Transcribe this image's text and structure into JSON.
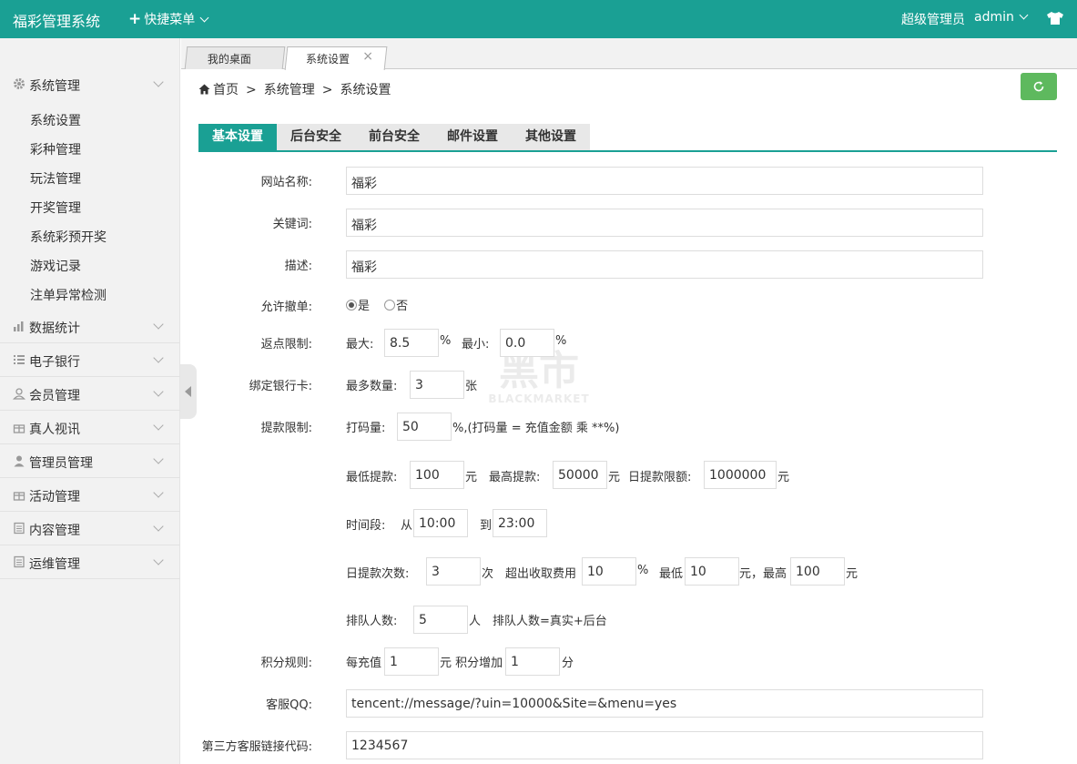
{
  "topbar": {
    "brand": "福彩管理系统",
    "quick_menu": "快捷菜单",
    "role": "超级管理员",
    "user": "admin"
  },
  "sidebar": {
    "groups": [
      {
        "label": "系统管理",
        "icon": "gear-icon"
      },
      {
        "label": "数据统计",
        "icon": "bar-chart-icon"
      },
      {
        "label": "电子银行",
        "icon": "list-icon"
      },
      {
        "label": "会员管理",
        "icon": "user-outline-icon"
      },
      {
        "label": "真人视讯",
        "icon": "gift-icon"
      },
      {
        "label": "管理员管理",
        "icon": "user-icon"
      },
      {
        "label": "活动管理",
        "icon": "gift-icon"
      },
      {
        "label": "内容管理",
        "icon": "document-icon"
      },
      {
        "label": "运维管理",
        "icon": "document-icon"
      }
    ],
    "sub_items": [
      "系统设置",
      "彩种管理",
      "玩法管理",
      "开奖管理",
      "系统彩预开奖",
      "游戏记录",
      "注单异常检测"
    ]
  },
  "page_tabs": [
    {
      "label": "我的桌面"
    },
    {
      "label": "系统设置",
      "close": "×"
    }
  ],
  "breadcrumb": {
    "home": "首页",
    "sep": ">",
    "level1": "系统管理",
    "level2": "系统设置"
  },
  "settings_tabs": [
    "基本设置",
    "后台安全",
    "前台安全",
    "邮件设置",
    "其他设置"
  ],
  "watermark": {
    "big": "黑市",
    "small": "BLACKMARKET"
  },
  "form": {
    "site_name": {
      "label": "网站名称:",
      "value": "福彩"
    },
    "keywords": {
      "label": "关键词:",
      "value": "福彩"
    },
    "description": {
      "label": "描述:",
      "value": "福彩"
    },
    "allow_cancel": {
      "label": "允许撤单:",
      "yes": "是",
      "no": "否"
    },
    "rebate": {
      "label": "返点限制:",
      "max_label": "最大:",
      "max": "8.5",
      "pct1": "%",
      "min_label": "最小:",
      "min": "0.0",
      "pct2": "%"
    },
    "bank_card": {
      "label": "绑定银行卡:",
      "max_label": "最多数量:",
      "value": "3",
      "unit": "张"
    },
    "withdraw": {
      "label": "提款限制:",
      "bet_label": "打码量:",
      "bet": "50",
      "bet_note": "%,(打码量 = 充值金额 乘 **%)",
      "min_label": "最低提款:",
      "min": "100",
      "unit_yuan1": "元",
      "max_label": "最高提款:",
      "max": "50000",
      "unit_yuan2": "元",
      "daily_label": "日提款限额:",
      "daily": "1000000",
      "unit_yuan3": "元",
      "time_label": "时间段:",
      "from_label": "从",
      "from": "10:00",
      "to_label": "到",
      "to": "23:00",
      "count_label": "日提款次数:",
      "count": "3",
      "count_unit": "次",
      "fee_label": "超出收取费用",
      "fee": "10",
      "fee_pct": "%",
      "fee_min_label": "最低",
      "fee_min": "10",
      "fee_max_label": "元，最高",
      "fee_max": "100",
      "fee_unit": "元",
      "queue_label": "排队人数:",
      "queue": "5",
      "queue_unit": "人",
      "queue_note": "排队人数=真实+后台"
    },
    "points": {
      "label": "积分规则:",
      "recharge_label": "每充值",
      "recharge": "1",
      "mid": "元 积分增加",
      "points": "1",
      "unit": "分"
    },
    "qq": {
      "label": "客服QQ:",
      "value": "tencent://message/?uin=10000&Site=&menu=yes"
    },
    "third_party": {
      "label": "第三方客服链接代码:",
      "value": "1234567"
    }
  }
}
